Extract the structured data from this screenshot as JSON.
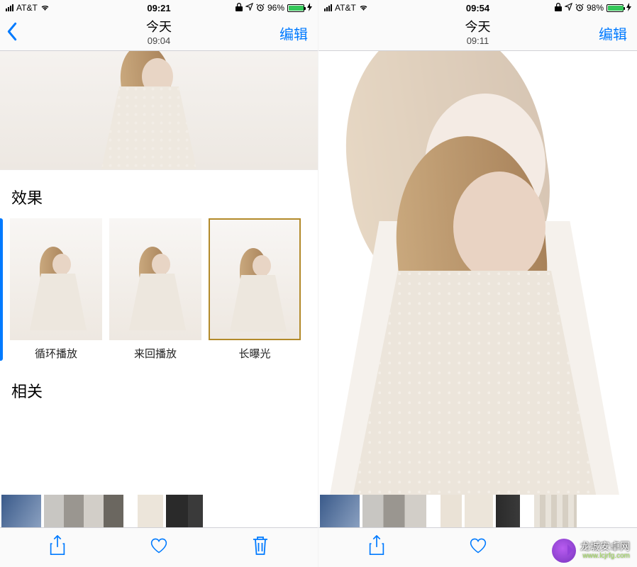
{
  "left": {
    "status": {
      "carrier": "AT&T",
      "time": "09:21",
      "battery_pct": "96%",
      "battery_fill_pct": 96
    },
    "nav": {
      "title": "今天",
      "subtitle": "09:04",
      "edit": "编辑"
    },
    "effects": {
      "header": "效果",
      "items": [
        {
          "label": "循环播放",
          "selected": false
        },
        {
          "label": "来回播放",
          "selected": false
        },
        {
          "label": "长曝光",
          "selected": true
        }
      ]
    },
    "related": {
      "header": "相关"
    }
  },
  "right": {
    "status": {
      "carrier": "AT&T",
      "time": "09:54",
      "battery_pct": "98%",
      "battery_fill_pct": 98
    },
    "nav": {
      "title": "今天",
      "subtitle": "09:11",
      "edit": "编辑"
    }
  },
  "watermark": {
    "line1": "龙城安卓网",
    "line2": "www.lcjrfg.com"
  },
  "icons": {
    "share": "share-icon",
    "heart": "heart-icon",
    "trash": "trash-icon",
    "back": "chevron-left-icon",
    "lock": "lock-icon",
    "location": "location-icon",
    "alarm": "alarm-icon",
    "bolt": "bolt-icon"
  },
  "colors": {
    "ios_blue": "#007aff",
    "battery_green": "#34c759",
    "selected_gold": "#b38a2a"
  }
}
